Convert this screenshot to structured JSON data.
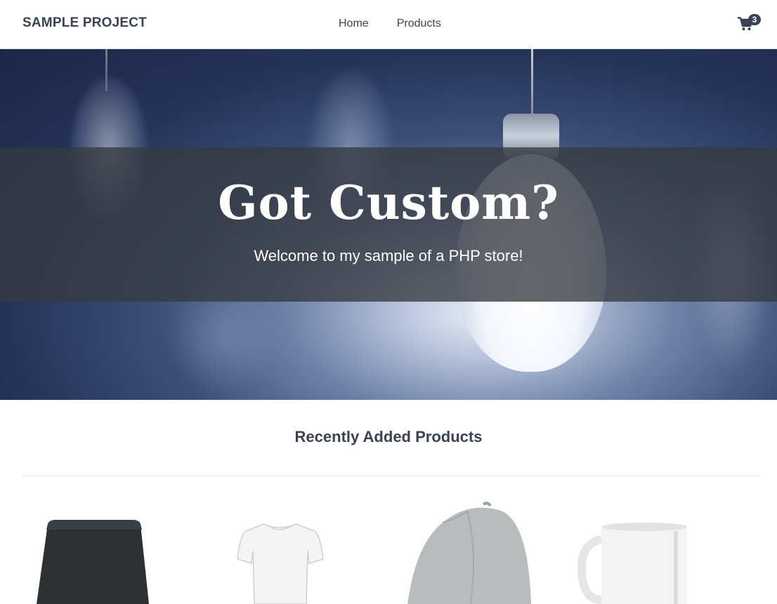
{
  "header": {
    "brand": "SAMPLE PROJECT",
    "nav": [
      {
        "label": "Home"
      },
      {
        "label": "Products"
      }
    ],
    "cart": {
      "icon": "shopping-cart-icon",
      "count": "3"
    }
  },
  "hero": {
    "title": "Got Custom?",
    "subtitle": "Welcome to my sample of a PHP store!"
  },
  "section": {
    "title": "Recently Added Products"
  },
  "products": [
    {
      "image": "black-mousepad"
    },
    {
      "image": "white-tshirt"
    },
    {
      "image": "grey-cap"
    },
    {
      "image": "white-mug"
    }
  ],
  "colors": {
    "text": "#394352",
    "hero_overlay": "#373a40",
    "badge": "#394352"
  }
}
